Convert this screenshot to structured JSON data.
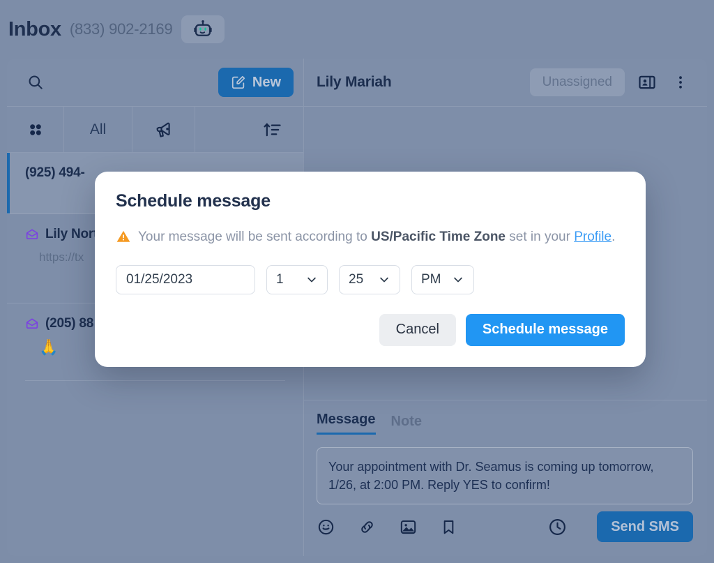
{
  "topbar": {
    "title": "Inbox",
    "phone": "(833) 902-2169",
    "bot_icon": "robot-icon"
  },
  "sidebar": {
    "search_placeholder": "",
    "new_button_label": "New",
    "filters": {
      "grid_icon": "grid-icon",
      "all_label": "All",
      "broadcast_icon": "megaphone-icon",
      "sort_icon": "sort-ascending-icon"
    },
    "conversations": [
      {
        "title": "(925) 494-",
        "snippet": "",
        "emoji": "",
        "active": true,
        "has_envelope": false
      },
      {
        "title": "Lily Nort",
        "snippet": "https://tx",
        "emoji": "",
        "active": false,
        "has_envelope": true
      },
      {
        "title": "(205) 88",
        "snippet": "",
        "emoji": "🙏",
        "active": false,
        "has_envelope": true
      }
    ]
  },
  "thread": {
    "contact_name": "Lily Mariah",
    "assignment_label": "Unassigned",
    "contact_card_icon": "contact-card-icon",
    "more_icon": "more-vertical-icon"
  },
  "composer": {
    "tabs": [
      {
        "label": "Message",
        "active": true
      },
      {
        "label": "Note",
        "active": false
      }
    ],
    "message_text": "Your appointment with Dr. Seamus is coming up tomorrow, 1/26, at 2:00 PM. Reply YES to confirm!",
    "tools": [
      {
        "icon": "emoji-smiley-icon"
      },
      {
        "icon": "link-icon"
      },
      {
        "icon": "image-icon"
      },
      {
        "icon": "bookmark-icon"
      }
    ],
    "schedule_icon": "clock-icon",
    "send_label": "Send SMS"
  },
  "modal": {
    "title": "Schedule message",
    "warning_icon": "warning-triangle-icon",
    "warning_prefix": "Your message will be sent according to ",
    "warning_timezone": "US/Pacific Time Zone",
    "warning_middle": " set in your ",
    "warning_link": "Profile",
    "warning_suffix": ".",
    "date_value": "01/25/2023",
    "hour_value": "1",
    "minute_value": "25",
    "ampm_value": "PM",
    "cancel_label": "Cancel",
    "confirm_label": "Schedule message"
  },
  "colors": {
    "backdrop": "#7d8da8",
    "accent_blue": "#1b69ae",
    "modal_blue": "#2196f3",
    "warning_orange": "#f59a22",
    "link_blue": "#3b9cf5",
    "envelope_purple": "#7b3fe4",
    "text_dark": "#1c2e4f"
  }
}
